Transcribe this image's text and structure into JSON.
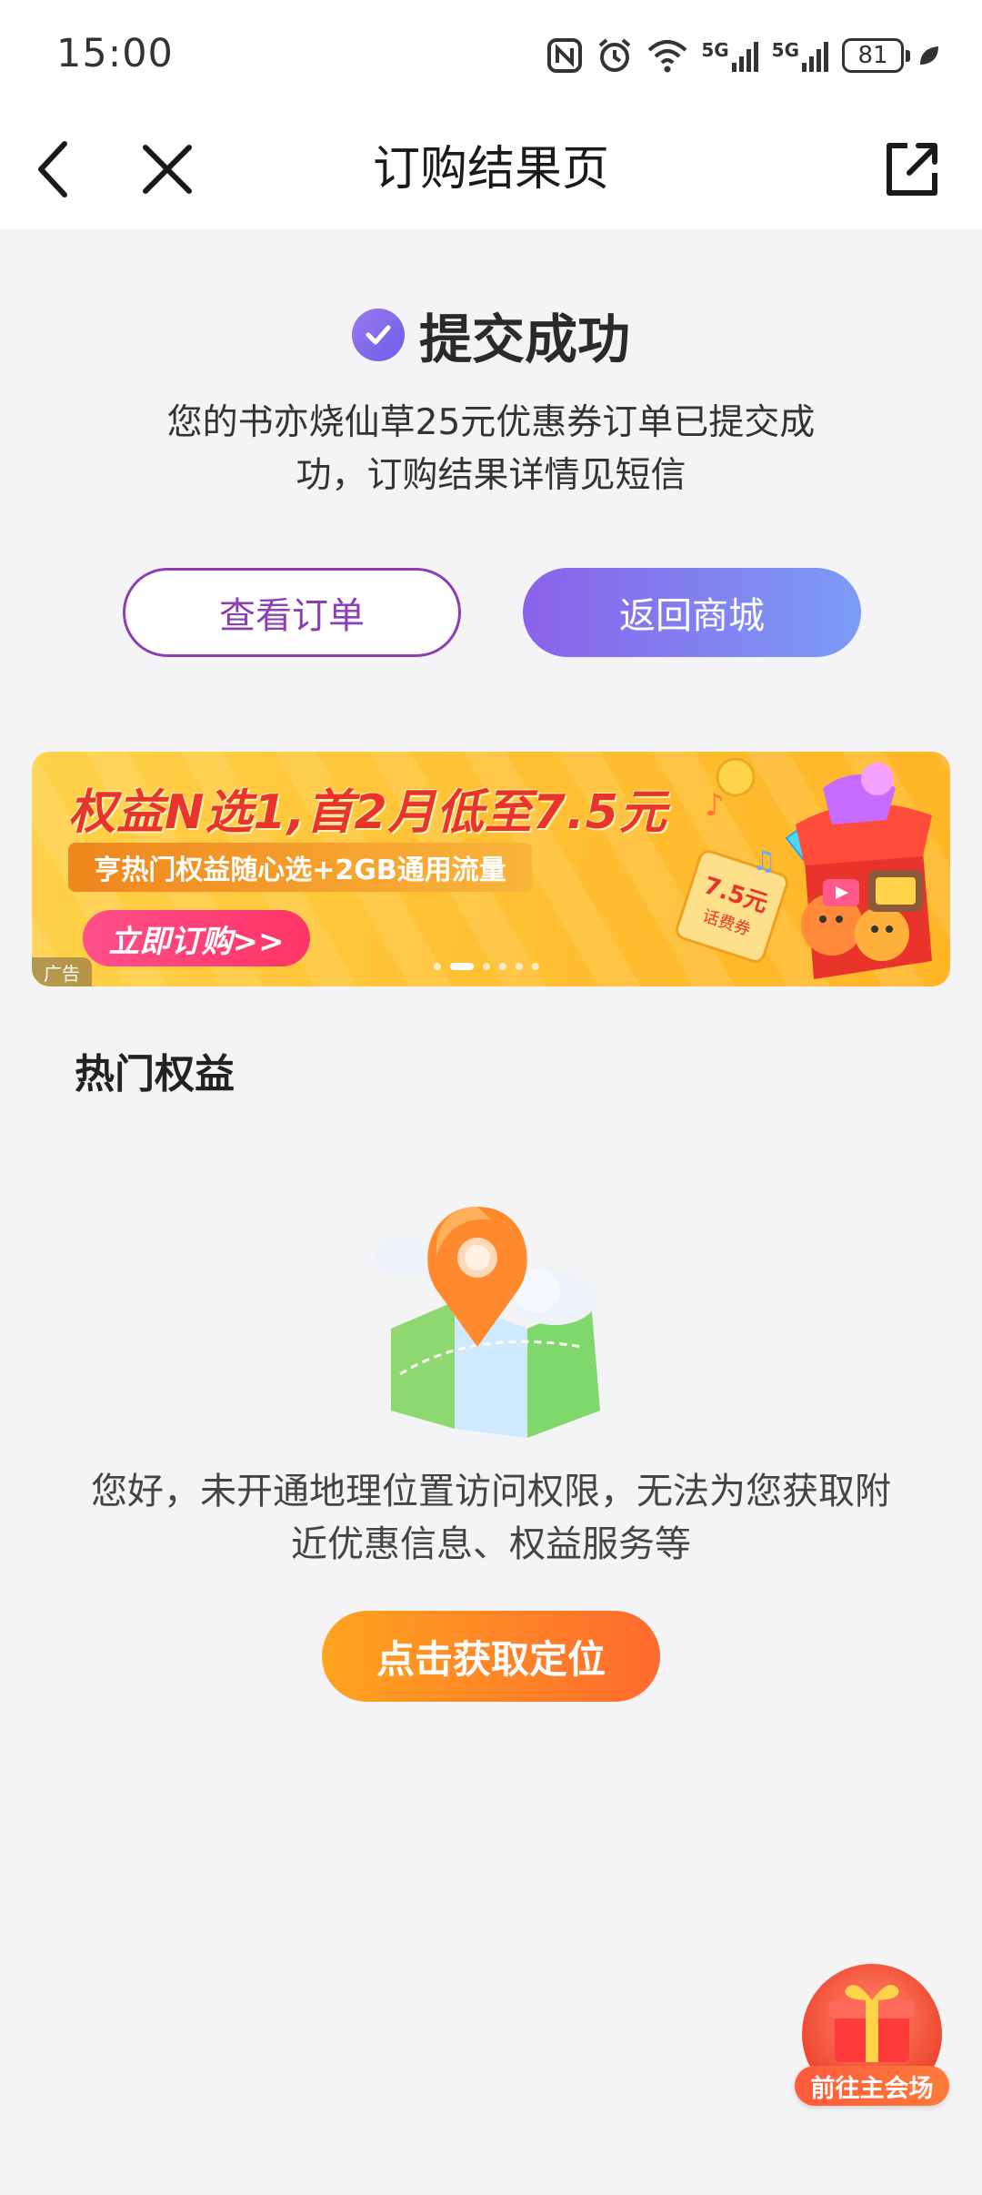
{
  "status_bar": {
    "time": "15:00",
    "signal_1": "5G",
    "signal_2": "5G",
    "battery": "81"
  },
  "header": {
    "title": "订购结果页",
    "back_icon": "chevron-left-icon",
    "close_icon": "close-icon",
    "share_icon": "share-external-icon"
  },
  "result": {
    "title": "提交成功",
    "message": "您的书亦烧仙草25元优惠券订单已提交成功，订购结果详情见短信",
    "view_order_label": "查看订单",
    "back_to_mall_label": "返回商城"
  },
  "banner": {
    "title": "权益N选1,首2月低至7.5元",
    "subtitle": "亨热门权益随心选+2GB通用流量",
    "cta": "立即订购>>",
    "ad_tag": "广告",
    "coupon_text": "7.5元",
    "coupon_sub": "话费券",
    "slides": 6,
    "active_slide": 2
  },
  "hot": {
    "title": "热门权益",
    "location_message": "您好，未开通地理位置访问权限，无法为您获取附近优惠信息、权益服务等",
    "location_button": "点击获取定位"
  },
  "float": {
    "label": "前往主会场"
  },
  "colors": {
    "accent_purple": "#8b3fb3",
    "button_gradient_start": "#8a62ea",
    "button_gradient_end": "#7b9cf6",
    "orange_start": "#ffa41f",
    "orange_end": "#ff6a2e"
  }
}
